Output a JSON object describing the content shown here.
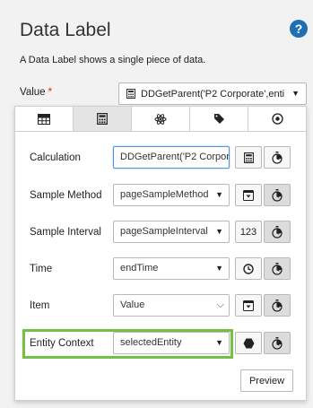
{
  "header": {
    "title": "Data Label",
    "help_label": "?",
    "description": "A Data Label shows a single piece of data."
  },
  "value": {
    "label": "Value",
    "required_marker": "*",
    "selected": "DDGetParent('P2 Corporate',enti",
    "arrow": "▼"
  },
  "tabs": [
    {
      "icon": "table-icon"
    },
    {
      "icon": "calculator-icon"
    },
    {
      "icon": "atom-icon"
    },
    {
      "icon": "tag-icon"
    },
    {
      "icon": "target-icon"
    }
  ],
  "rows": [
    {
      "label": "Calculation",
      "value": "DDGetParent('P2 Corpor",
      "btn1_icon": "calculator-icon",
      "btn2_icon": "stopwatch-icon"
    },
    {
      "label": "Sample Method",
      "value": "pageSampleMethod",
      "btn1_icon": "dropdown-box-icon",
      "btn2_icon": "stopwatch-icon"
    },
    {
      "label": "Sample Interval",
      "value": "pageSampleInterval",
      "btn1_label": "123",
      "btn2_icon": "stopwatch-icon"
    },
    {
      "label": "Time",
      "value": "endTime",
      "btn1_icon": "clock-icon",
      "btn2_icon": "stopwatch-icon"
    },
    {
      "label": "Item",
      "value": "Value",
      "btn1_icon": "dropdown-box-icon",
      "btn2_icon": "stopwatch-icon"
    },
    {
      "label": "Entity Context",
      "value": "selectedEntity",
      "btn1_icon": "hexagon-icon",
      "btn2_icon": "stopwatch-icon"
    }
  ],
  "preview_label": "Preview",
  "colors": {
    "accent": "#1f6fb5",
    "highlight": "#74c043",
    "required": "#d9241c"
  }
}
